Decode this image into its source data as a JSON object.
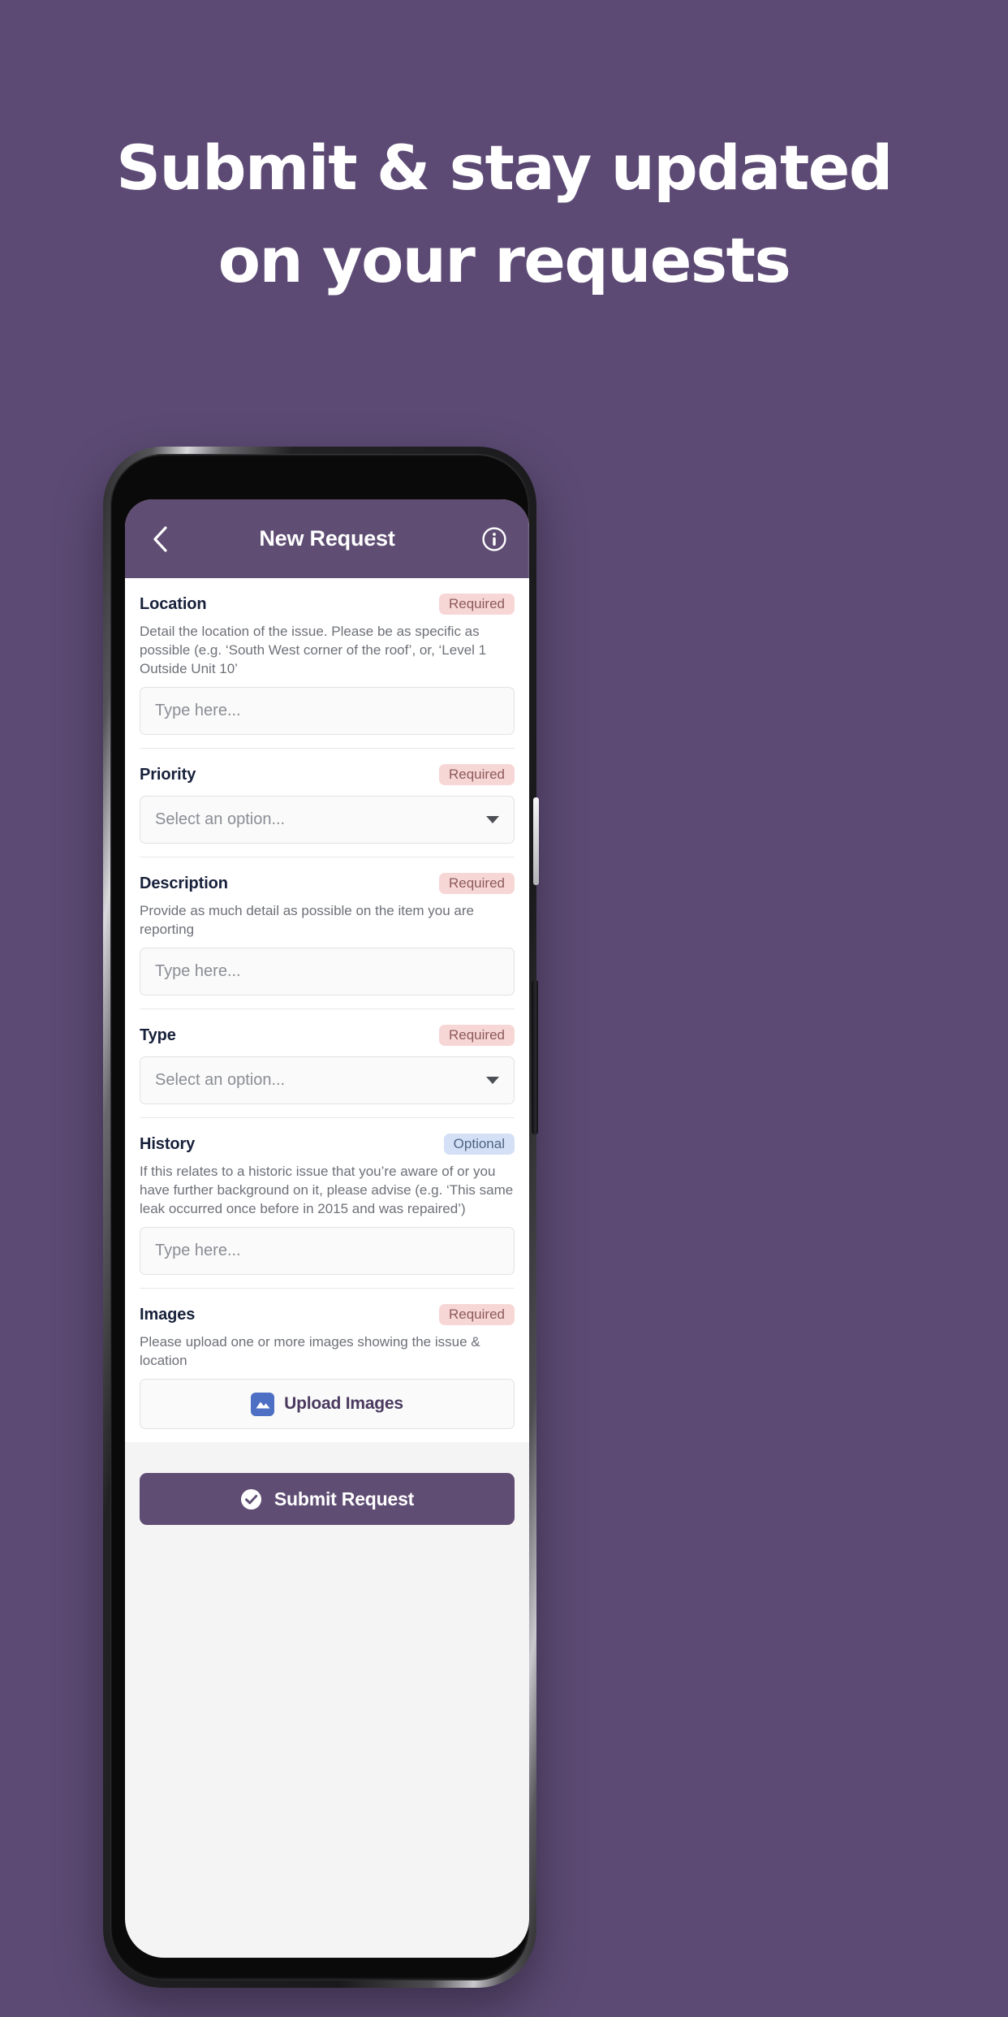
{
  "promo": {
    "headline_line1": "Submit & stay updated",
    "headline_line2": "on your requests",
    "background_color": "#5C4A74"
  },
  "device": {
    "camera_icon": "front-camera",
    "sensor_icon": "proximity-sensor",
    "speaker_icon": "earpiece-speaker",
    "power_button": "power-button",
    "volume_button": "volume-button"
  },
  "app": {
    "header": {
      "back_icon": "chevron-left-icon",
      "title": "New Request",
      "info_icon": "info-circle-icon",
      "background_color": "#5F4D73"
    },
    "form": {
      "fields": [
        {
          "label": "Location",
          "badge": "Required",
          "badge_type": "required",
          "help": "Detail the location of the issue. Please be as specific as possible (e.g. ‘South West corner of the roof’, or, ‘Level 1 Outside Unit 10’",
          "control": "text",
          "placeholder": "Type here..."
        },
        {
          "label": "Priority",
          "badge": "Required",
          "badge_type": "required",
          "help": "",
          "control": "select",
          "placeholder": "Select an option..."
        },
        {
          "label": "Description",
          "badge": "Required",
          "badge_type": "required",
          "help": "Provide as much detail as possible on the item you are reporting",
          "control": "text",
          "placeholder": "Type here..."
        },
        {
          "label": "Type",
          "badge": "Required",
          "badge_type": "required",
          "help": "",
          "control": "select",
          "placeholder": "Select an option..."
        },
        {
          "label": "History",
          "badge": "Optional",
          "badge_type": "optional",
          "help": "If this relates to a historic issue that you’re aware of or you have further background on it, please advise (e.g. ‘This same leak occurred once before in 2015 and was repaired’)",
          "control": "text",
          "placeholder": "Type here..."
        },
        {
          "label": "Images",
          "badge": "Required",
          "badge_type": "required",
          "help": "Please upload one or more images showing the issue & location",
          "control": "upload",
          "placeholder": "Upload Images",
          "upload_icon": "image-icon"
        }
      ]
    },
    "submit": {
      "label": "Submit Request",
      "icon": "check-circle-icon",
      "color": "#5F4D73"
    }
  },
  "badge_colors": {
    "required_bg": "#F7D6D6",
    "required_fg": "#8D5A5A",
    "optional_bg": "#D4E0F5",
    "optional_fg": "#4E6383"
  }
}
